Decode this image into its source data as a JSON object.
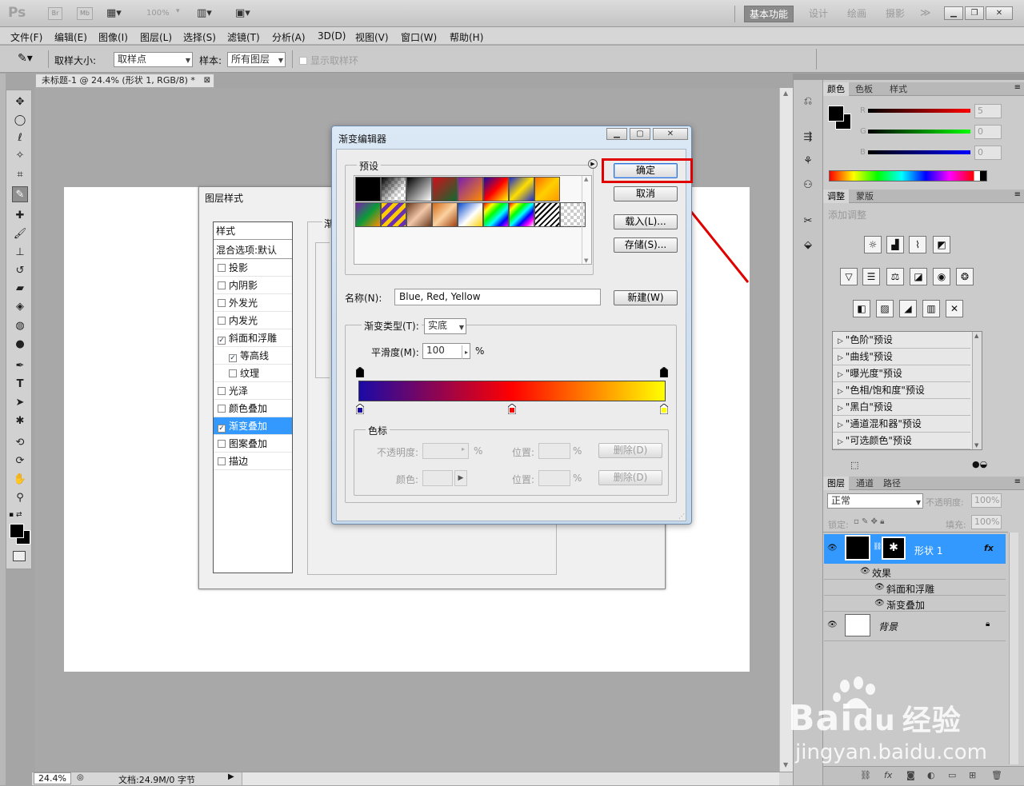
{
  "app": {
    "logo": "Ps",
    "br": "Br",
    "mb": "Mb",
    "zoom": "100%"
  },
  "workspace": {
    "active": "基本功能",
    "others": [
      "设计",
      "绘画",
      "摄影"
    ],
    "more": "≫"
  },
  "menu": [
    "文件(F)",
    "编辑(E)",
    "图像(I)",
    "图层(L)",
    "选择(S)",
    "滤镜(T)",
    "分析(A)",
    "3D(D)",
    "视图(V)",
    "窗口(W)",
    "帮助(H)"
  ],
  "options": {
    "sample_size_label": "取样大小:",
    "sample_size_value": "取样点",
    "sample_label": "样本:",
    "sample_value": "所有图层",
    "show_ring": "显示取样环"
  },
  "document": {
    "tab": "未标题-1 @ 24.4% (形状 1, RGB/8) *",
    "zoom": "24.4%",
    "info": "文档:24.9M/0 字节"
  },
  "layer_style": {
    "title": "图层样式",
    "list_header": "样式",
    "blend": "混合选项:默认",
    "items": [
      {
        "label": "投影",
        "checked": false,
        "sub": false
      },
      {
        "label": "内阴影",
        "checked": false,
        "sub": false
      },
      {
        "label": "外发光",
        "checked": false,
        "sub": false
      },
      {
        "label": "内发光",
        "checked": false,
        "sub": false
      },
      {
        "label": "斜面和浮雕",
        "checked": true,
        "sub": false
      },
      {
        "label": "等高线",
        "checked": true,
        "sub": true
      },
      {
        "label": "纹理",
        "checked": false,
        "sub": true
      },
      {
        "label": "光泽",
        "checked": false,
        "sub": false
      },
      {
        "label": "颜色叠加",
        "checked": false,
        "sub": false
      },
      {
        "label": "渐变叠加",
        "checked": true,
        "sub": false,
        "selected": true
      },
      {
        "label": "图案叠加",
        "checked": false,
        "sub": false
      },
      {
        "label": "描边",
        "checked": false,
        "sub": false
      }
    ],
    "panel_partial": "渐"
  },
  "gradient_editor": {
    "title": "渐变编辑器",
    "presets_label": "预设",
    "ok": "确定",
    "cancel": "取消",
    "load": "载入(L)...",
    "save": "存储(S)...",
    "name_label": "名称(N):",
    "name_value": "Blue, Red, Yellow",
    "new": "新建(W)",
    "type_label": "渐变类型(T):",
    "type_value": "实底",
    "smooth_label": "平滑度(M):",
    "smooth_value": "100",
    "percent": "%",
    "stops_group": "色标",
    "opacity_label": "不透明度:",
    "location_label": "位置:",
    "delete": "删除(D)",
    "color_label": "颜色:",
    "gradient_colors": [
      "#1a0aa6",
      "#ff0000",
      "#ffff00"
    ]
  },
  "color_panel": {
    "tabs": [
      "颜色",
      "色板",
      "样式"
    ],
    "r_label": "R",
    "g_label": "G",
    "b_label": "B",
    "r": "5",
    "g": "0",
    "b": "0"
  },
  "adjust_panel": {
    "tabs": [
      "调整",
      "蒙版"
    ],
    "title": "添加调整",
    "presets": [
      "\"色阶\"预设",
      "\"曲线\"预设",
      "\"曝光度\"预设",
      "\"色相/饱和度\"预设",
      "\"黑白\"预设",
      "\"通道混和器\"预设",
      "\"可选颜色\"预设"
    ]
  },
  "layers_panel": {
    "tabs": [
      "图层",
      "通道",
      "路径"
    ],
    "blend_mode": "正常",
    "opacity_label": "不透明度:",
    "opacity": "100%",
    "lock_label": "锁定:",
    "fill_label": "填充:",
    "fill": "100%",
    "layers": {
      "shape": "形状 1",
      "fx": "fx",
      "effects": "效果",
      "effect1": "斜面和浮雕",
      "effect2": "渐变叠加",
      "bg": "背景"
    }
  },
  "watermark": {
    "brand": "Bai",
    "brand2": "du",
    "cn": "经验",
    "url": "jingyan.baidu.com"
  }
}
